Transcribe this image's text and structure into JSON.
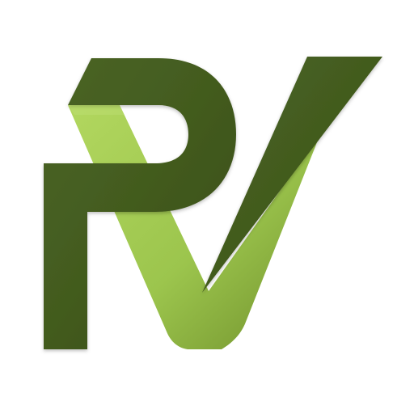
{
  "logo": {
    "monogram_text": "PV",
    "colors": {
      "background": "#ffffff",
      "dark_green": "#435c1f",
      "dark_green_shadow": "#36491a",
      "light_green": "#9cc54d",
      "light_green_shade": "#6f8f2b"
    }
  }
}
